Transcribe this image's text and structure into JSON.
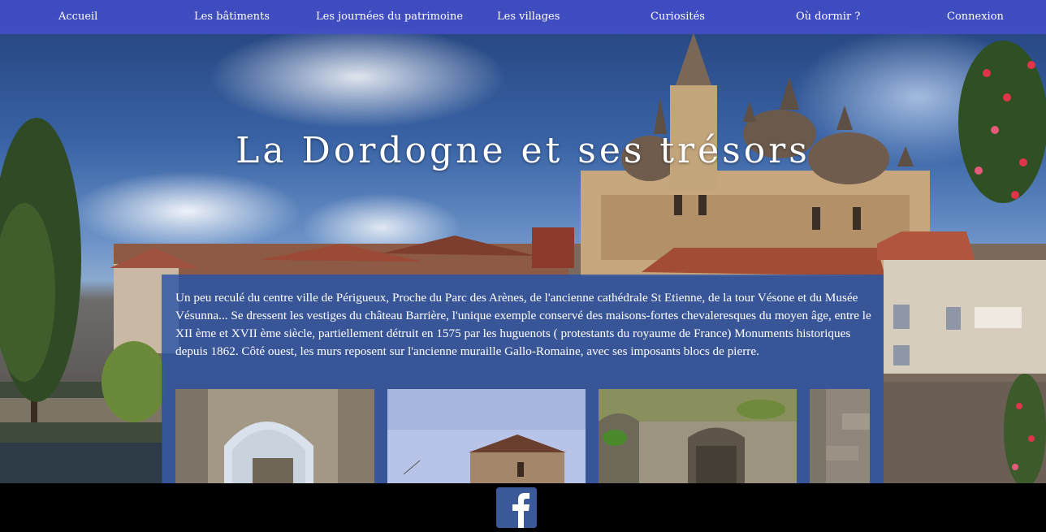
{
  "nav": {
    "items": [
      {
        "label": "Accueil"
      },
      {
        "label": "Les bâtiments"
      },
      {
        "label": "Les journées du patrimoine"
      },
      {
        "label": "Les villages"
      },
      {
        "label": "Curiosités"
      },
      {
        "label": "Où dormir ?"
      },
      {
        "label": "Connexion"
      }
    ]
  },
  "hero": {
    "title": "La Dordogne et ses trésors"
  },
  "content": {
    "intro": "Un peu reculé du centre ville de Périgueux, Proche du Parc des Arènes, de l'ancienne cathédrale St Etienne, de la tour Vésone et du Musée Vésunna... Se dressent les vestiges du château Barrière, l'unique exemple conservé des maisons-fortes chevaleresques du moyen âge, entre le XII ème et XVII ème siècle, partiellement détruit en 1575 par les huguenots ( protestants du royaume de France) Monuments historiques depuis 1862. Côté ouest, les murs reposent sur l'ancienne muraille Gallo-Romaine, avec ses imposants blocs de pierre.",
    "gallery": [
      {
        "subject": "stone-archway-ruin"
      },
      {
        "subject": "stone-chapel-gable"
      },
      {
        "subject": "overgrown-stone-doorway"
      },
      {
        "subject": "stone-wall-fragment"
      }
    ]
  },
  "footer": {
    "social_icon": "facebook-icon",
    "brand_color": "#3b5998"
  },
  "colors": {
    "navbar": "#4650d2",
    "panel": "#2850a5"
  }
}
